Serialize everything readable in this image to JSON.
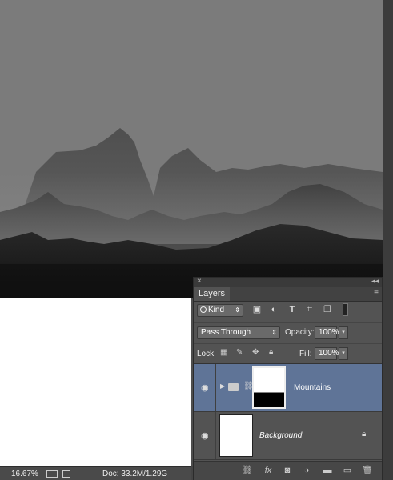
{
  "status_bar": {
    "zoom": "16.67%",
    "doc": "Doc: 33.2M/1.29G"
  },
  "layers_panel": {
    "tab": "Layers",
    "filter_kind": "Kind",
    "blend_mode": "Pass Through",
    "opacity_label": "Opacity:",
    "opacity_value": "100%",
    "lock_label": "Lock:",
    "fill_label": "Fill:",
    "fill_value": "100%",
    "layers": [
      {
        "name": "Mountains",
        "type": "group",
        "selected": true
      },
      {
        "name": "Background",
        "type": "pixel",
        "locked": true,
        "selected": false
      }
    ]
  },
  "icons": {
    "filter": [
      "image-filter-icon",
      "adjustment-filter-icon",
      "type-filter-icon",
      "shape-filter-icon",
      "smart-object-filter-icon"
    ],
    "lock": [
      "lock-transparent-icon",
      "lock-image-icon",
      "lock-position-icon",
      "lock-all-icon"
    ],
    "footer": [
      "link-layers-icon",
      "fx-icon",
      "add-mask-icon",
      "new-adjustment-icon",
      "new-group-icon",
      "new-layer-icon",
      "delete-layer-icon"
    ]
  },
  "colors": {
    "selected_row": "#5f7497",
    "panel_bg": "#535353",
    "canvas_sky": "#7b7b7b"
  }
}
